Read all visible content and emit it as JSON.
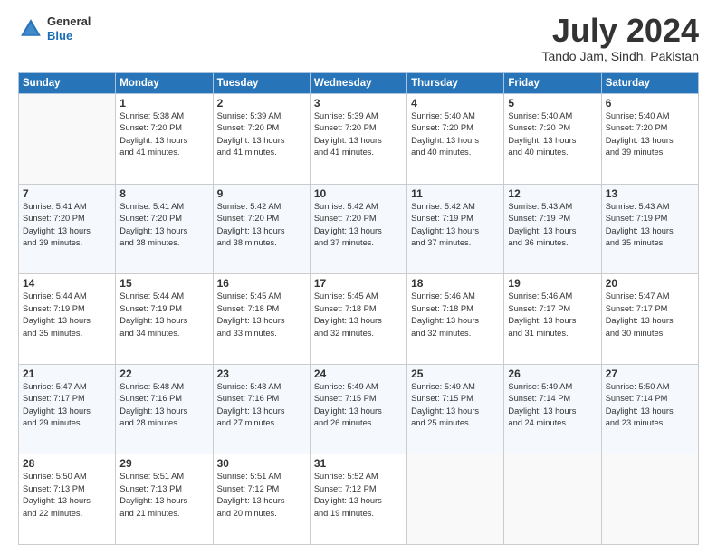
{
  "header": {
    "logo_general": "General",
    "logo_blue": "Blue",
    "title": "July 2024",
    "location": "Tando Jam, Sindh, Pakistan"
  },
  "days_header": [
    "Sunday",
    "Monday",
    "Tuesday",
    "Wednesday",
    "Thursday",
    "Friday",
    "Saturday"
  ],
  "weeks": [
    [
      {
        "day": "",
        "info": ""
      },
      {
        "day": "1",
        "info": "Sunrise: 5:38 AM\nSunset: 7:20 PM\nDaylight: 13 hours\nand 41 minutes."
      },
      {
        "day": "2",
        "info": "Sunrise: 5:39 AM\nSunset: 7:20 PM\nDaylight: 13 hours\nand 41 minutes."
      },
      {
        "day": "3",
        "info": "Sunrise: 5:39 AM\nSunset: 7:20 PM\nDaylight: 13 hours\nand 41 minutes."
      },
      {
        "day": "4",
        "info": "Sunrise: 5:40 AM\nSunset: 7:20 PM\nDaylight: 13 hours\nand 40 minutes."
      },
      {
        "day": "5",
        "info": "Sunrise: 5:40 AM\nSunset: 7:20 PM\nDaylight: 13 hours\nand 40 minutes."
      },
      {
        "day": "6",
        "info": "Sunrise: 5:40 AM\nSunset: 7:20 PM\nDaylight: 13 hours\nand 39 minutes."
      }
    ],
    [
      {
        "day": "7",
        "info": "Sunrise: 5:41 AM\nSunset: 7:20 PM\nDaylight: 13 hours\nand 39 minutes."
      },
      {
        "day": "8",
        "info": "Sunrise: 5:41 AM\nSunset: 7:20 PM\nDaylight: 13 hours\nand 38 minutes."
      },
      {
        "day": "9",
        "info": "Sunrise: 5:42 AM\nSunset: 7:20 PM\nDaylight: 13 hours\nand 38 minutes."
      },
      {
        "day": "10",
        "info": "Sunrise: 5:42 AM\nSunset: 7:20 PM\nDaylight: 13 hours\nand 37 minutes."
      },
      {
        "day": "11",
        "info": "Sunrise: 5:42 AM\nSunset: 7:19 PM\nDaylight: 13 hours\nand 37 minutes."
      },
      {
        "day": "12",
        "info": "Sunrise: 5:43 AM\nSunset: 7:19 PM\nDaylight: 13 hours\nand 36 minutes."
      },
      {
        "day": "13",
        "info": "Sunrise: 5:43 AM\nSunset: 7:19 PM\nDaylight: 13 hours\nand 35 minutes."
      }
    ],
    [
      {
        "day": "14",
        "info": "Sunrise: 5:44 AM\nSunset: 7:19 PM\nDaylight: 13 hours\nand 35 minutes."
      },
      {
        "day": "15",
        "info": "Sunrise: 5:44 AM\nSunset: 7:19 PM\nDaylight: 13 hours\nand 34 minutes."
      },
      {
        "day": "16",
        "info": "Sunrise: 5:45 AM\nSunset: 7:18 PM\nDaylight: 13 hours\nand 33 minutes."
      },
      {
        "day": "17",
        "info": "Sunrise: 5:45 AM\nSunset: 7:18 PM\nDaylight: 13 hours\nand 32 minutes."
      },
      {
        "day": "18",
        "info": "Sunrise: 5:46 AM\nSunset: 7:18 PM\nDaylight: 13 hours\nand 32 minutes."
      },
      {
        "day": "19",
        "info": "Sunrise: 5:46 AM\nSunset: 7:17 PM\nDaylight: 13 hours\nand 31 minutes."
      },
      {
        "day": "20",
        "info": "Sunrise: 5:47 AM\nSunset: 7:17 PM\nDaylight: 13 hours\nand 30 minutes."
      }
    ],
    [
      {
        "day": "21",
        "info": "Sunrise: 5:47 AM\nSunset: 7:17 PM\nDaylight: 13 hours\nand 29 minutes."
      },
      {
        "day": "22",
        "info": "Sunrise: 5:48 AM\nSunset: 7:16 PM\nDaylight: 13 hours\nand 28 minutes."
      },
      {
        "day": "23",
        "info": "Sunrise: 5:48 AM\nSunset: 7:16 PM\nDaylight: 13 hours\nand 27 minutes."
      },
      {
        "day": "24",
        "info": "Sunrise: 5:49 AM\nSunset: 7:15 PM\nDaylight: 13 hours\nand 26 minutes."
      },
      {
        "day": "25",
        "info": "Sunrise: 5:49 AM\nSunset: 7:15 PM\nDaylight: 13 hours\nand 25 minutes."
      },
      {
        "day": "26",
        "info": "Sunrise: 5:49 AM\nSunset: 7:14 PM\nDaylight: 13 hours\nand 24 minutes."
      },
      {
        "day": "27",
        "info": "Sunrise: 5:50 AM\nSunset: 7:14 PM\nDaylight: 13 hours\nand 23 minutes."
      }
    ],
    [
      {
        "day": "28",
        "info": "Sunrise: 5:50 AM\nSunset: 7:13 PM\nDaylight: 13 hours\nand 22 minutes."
      },
      {
        "day": "29",
        "info": "Sunrise: 5:51 AM\nSunset: 7:13 PM\nDaylight: 13 hours\nand 21 minutes."
      },
      {
        "day": "30",
        "info": "Sunrise: 5:51 AM\nSunset: 7:12 PM\nDaylight: 13 hours\nand 20 minutes."
      },
      {
        "day": "31",
        "info": "Sunrise: 5:52 AM\nSunset: 7:12 PM\nDaylight: 13 hours\nand 19 minutes."
      },
      {
        "day": "",
        "info": ""
      },
      {
        "day": "",
        "info": ""
      },
      {
        "day": "",
        "info": ""
      }
    ]
  ]
}
